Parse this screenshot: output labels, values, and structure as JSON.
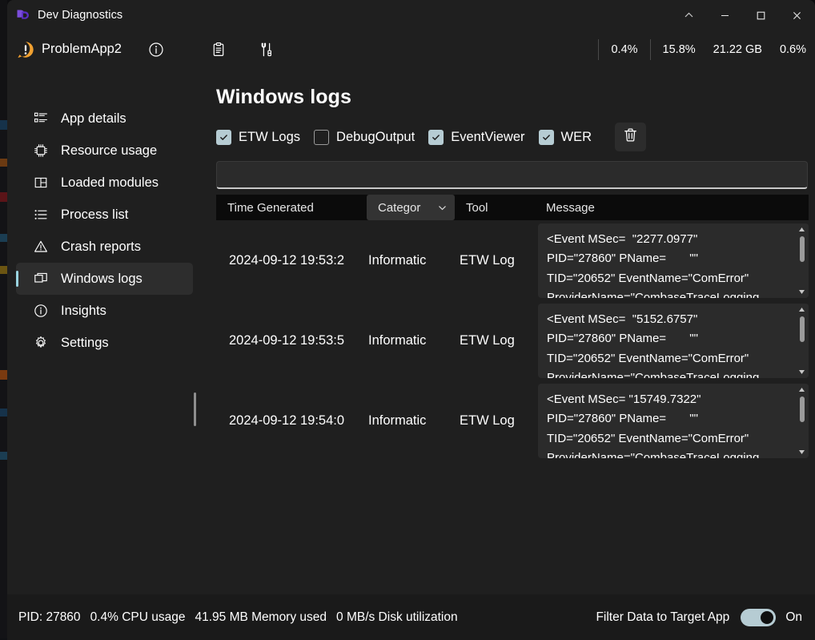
{
  "window": {
    "title": "Dev Diagnostics",
    "logo_icon": "dev-diagnostics-logo",
    "caption": {
      "chevron_up": "chevron-up-icon",
      "minimize": "minimize-icon",
      "maximize": "maximize-icon",
      "close": "close-icon"
    }
  },
  "app_bar": {
    "warning_icon": "warning-badge-icon",
    "target_app": "ProblemApp2",
    "icons": [
      {
        "name": "info-icon",
        "label": "About"
      },
      {
        "name": "clipboard-icon",
        "label": "Clipboard"
      },
      {
        "name": "tools-icon",
        "label": "Tools"
      }
    ],
    "perf": [
      {
        "name": "cpu",
        "value": "0.4%"
      },
      {
        "name": "gpu",
        "value": "15.8%"
      },
      {
        "name": "memory",
        "value": "21.22 GB"
      },
      {
        "name": "disk",
        "value": "0.6%"
      }
    ]
  },
  "sidebar": {
    "items": [
      {
        "label": "App details",
        "icon": "list-details-icon",
        "selected": false
      },
      {
        "label": "Resource usage",
        "icon": "cpu-chip-icon",
        "selected": false
      },
      {
        "label": "Loaded modules",
        "icon": "modules-grid-icon",
        "selected": false
      },
      {
        "label": "Process list",
        "icon": "bullet-list-icon",
        "selected": false
      },
      {
        "label": "Crash reports",
        "icon": "warning-triangle-icon",
        "selected": false
      },
      {
        "label": "Windows logs",
        "icon": "windows-logs-icon",
        "selected": true
      },
      {
        "label": "Insights",
        "icon": "info-circle-icon",
        "selected": false
      },
      {
        "label": "Settings",
        "icon": "gear-icon",
        "selected": false
      }
    ]
  },
  "main": {
    "title": "Windows logs",
    "filters": [
      {
        "label": "ETW Logs",
        "checked": true
      },
      {
        "label": "DebugOutput",
        "checked": false
      },
      {
        "label": "EventViewer",
        "checked": true
      },
      {
        "label": "WER",
        "checked": true
      }
    ],
    "clear_button_icon": "trash-icon",
    "search": {
      "value": "",
      "placeholder": ""
    },
    "table": {
      "columns": [
        {
          "key": "time",
          "label": "Time Generated",
          "dropdown": false
        },
        {
          "key": "category",
          "label": "Categor",
          "dropdown": true,
          "chevron_icon": "chevron-down-icon"
        },
        {
          "key": "tool",
          "label": "Tool",
          "dropdown": false
        },
        {
          "key": "message",
          "label": "Message",
          "dropdown": false
        }
      ],
      "rows": [
        {
          "time": "2024-09-12 19:53:2",
          "category": "Informatic",
          "tool": "ETW Log",
          "message": "<Event MSec=  \"2277.0977\"\nPID=\"27860\" PName=       \"\"\nTID=\"20652\" EventName=\"ComError\"\nProviderName=\"CombaseTraceLogging"
        },
        {
          "time": "2024-09-12 19:53:5",
          "category": "Informatic",
          "tool": "ETW Log",
          "message": "<Event MSec=  \"5152.6757\"\nPID=\"27860\" PName=       \"\"\nTID=\"20652\" EventName=\"ComError\"\nProviderName=\"CombaseTraceLogging"
        },
        {
          "time": "2024-09-12 19:54:0",
          "category": "Informatic",
          "tool": "ETW Log",
          "message": "<Event MSec= \"15749.7322\"\nPID=\"27860\" PName=       \"\"\nTID=\"20652\" EventName=\"ComError\"\nProviderName=\"CombaseTraceLogging"
        }
      ]
    }
  },
  "status_bar": {
    "pid": "PID: 27860",
    "cpu": "0.4% CPU usage",
    "memory": "41.95 MB Memory used",
    "disk": "0 MB/s Disk utilization",
    "filter_toggle_label": "Filter Data to Target App",
    "filter_toggle_state": "On"
  },
  "colors": {
    "accent_check": "#b6ccd3",
    "selection_bar": "#9ad4e0",
    "warning": "#f0a030",
    "logo": "#7b4ddb"
  }
}
